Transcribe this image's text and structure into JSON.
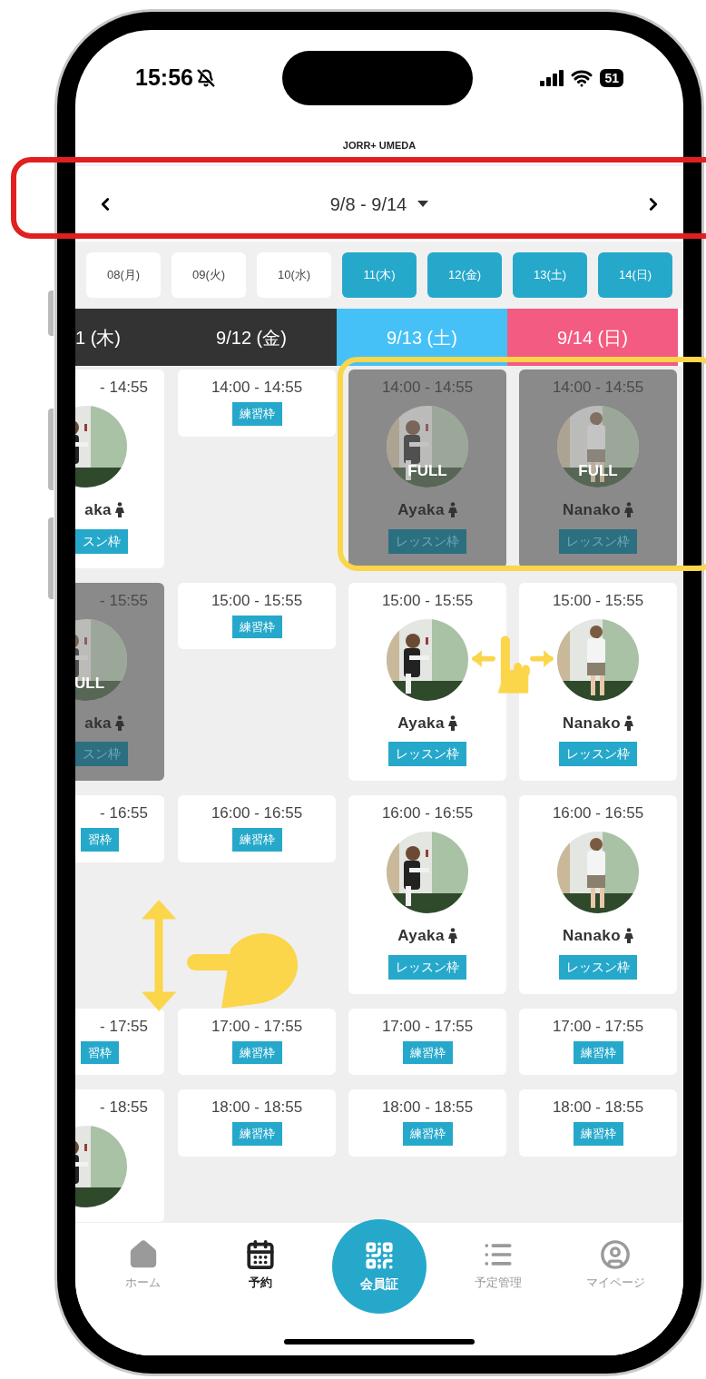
{
  "status_bar": {
    "time": "15:56",
    "battery": "51"
  },
  "title": "JORR+ UMEDA",
  "week": {
    "label": "9/8 - 9/14"
  },
  "days": [
    {
      "label": "08(月)",
      "selected": false
    },
    {
      "label": "09(火)",
      "selected": false
    },
    {
      "label": "10(水)",
      "selected": false
    },
    {
      "label": "11(木)",
      "selected": true
    },
    {
      "label": "12(金)",
      "selected": true
    },
    {
      "label": "13(土)",
      "selected": true
    },
    {
      "label": "14(日)",
      "selected": true
    }
  ],
  "schedule": {
    "columns": [
      {
        "header": "1 (木)",
        "color": "#333333",
        "kind": "edge"
      },
      {
        "header": "9/12 (金)",
        "color": "#333333",
        "kind": "day"
      },
      {
        "header": "9/13 (土)",
        "color": "#45c1f7",
        "kind": "day"
      },
      {
        "header": "9/14 (日)",
        "color": "#f45b82",
        "kind": "day"
      }
    ],
    "rows": [
      {
        "cells": [
          {
            "kind": "lesson",
            "time": "- 14:55",
            "name": "aka",
            "tag": "スン枠",
            "full": false
          },
          {
            "kind": "practice",
            "time": "14:00 - 14:55",
            "tag": "練習枠"
          },
          {
            "kind": "lesson",
            "time": "14:00 - 14:55",
            "name": "Ayaka",
            "tag": "レッスン枠",
            "full": true,
            "full_label": "FULL"
          },
          {
            "kind": "lesson",
            "time": "14:00 - 14:55",
            "name": "Nanako",
            "tag": "レッスン枠",
            "full": true,
            "full_label": "FULL"
          }
        ]
      },
      {
        "cells": [
          {
            "kind": "lesson",
            "time": "- 15:55",
            "name": "aka",
            "tag": "スン枠",
            "full": true,
            "full_label": "ULL"
          },
          {
            "kind": "practice",
            "time": "15:00 - 15:55",
            "tag": "練習枠"
          },
          {
            "kind": "lesson",
            "time": "15:00 - 15:55",
            "name": "Ayaka",
            "tag": "レッスン枠",
            "full": false
          },
          {
            "kind": "lesson",
            "time": "15:00 - 15:55",
            "name": "Nanako",
            "tag": "レッスン枠",
            "full": false
          }
        ]
      },
      {
        "cells": [
          {
            "kind": "practice",
            "time": "- 16:55",
            "tag": "習枠"
          },
          {
            "kind": "practice",
            "time": "16:00 - 16:55",
            "tag": "練習枠"
          },
          {
            "kind": "lesson",
            "time": "16:00 - 16:55",
            "name": "Ayaka",
            "tag": "レッスン枠",
            "full": false
          },
          {
            "kind": "lesson",
            "time": "16:00 - 16:55",
            "name": "Nanako",
            "tag": "レッスン枠",
            "full": false
          }
        ]
      },
      {
        "cells": [
          {
            "kind": "practice",
            "time": "- 17:55",
            "tag": "習枠"
          },
          {
            "kind": "practice",
            "time": "17:00 - 17:55",
            "tag": "練習枠"
          },
          {
            "kind": "practice",
            "time": "17:00 - 17:55",
            "tag": "練習枠"
          },
          {
            "kind": "practice",
            "time": "17:00 - 17:55",
            "tag": "練習枠"
          }
        ]
      },
      {
        "cells": [
          {
            "kind": "lesson",
            "time": "- 18:55",
            "full": false
          },
          {
            "kind": "practice",
            "time": "18:00 - 18:55",
            "tag": "練習枠"
          },
          {
            "kind": "practice",
            "time": "18:00 - 18:55",
            "tag": "練習枠"
          },
          {
            "kind": "practice",
            "time": "18:00 - 18:55",
            "tag": "練習枠"
          }
        ]
      }
    ]
  },
  "nav": [
    {
      "label": "ホーム",
      "kind": "home",
      "selected": false
    },
    {
      "label": "予約",
      "kind": "calendar",
      "selected": true
    },
    {
      "label": "会員証",
      "kind": "qr",
      "selected": false
    },
    {
      "label": "予定管理",
      "kind": "list",
      "selected": false
    },
    {
      "label": "マイページ",
      "kind": "user",
      "selected": false
    }
  ]
}
